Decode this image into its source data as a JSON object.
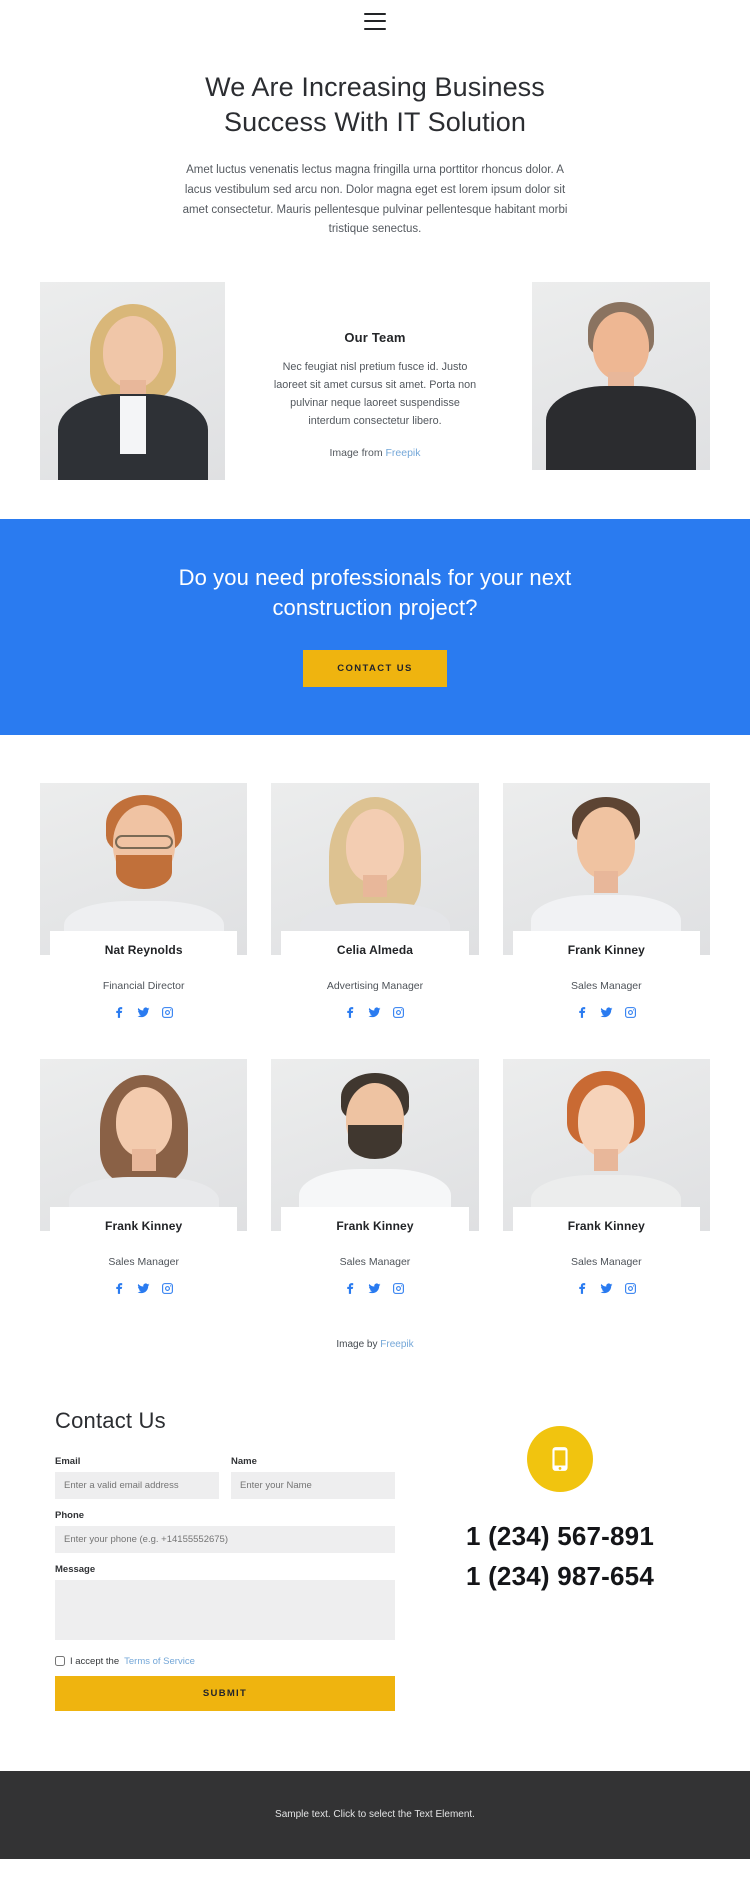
{
  "nav": {
    "menu_icon": "hamburger-menu-icon"
  },
  "hero": {
    "title_line1": "We Are Increasing Business",
    "title_line2": "Success With IT Solution",
    "lead": "Amet luctus venenatis lectus magna fringilla urna porttitor rhoncus dolor. A lacus vestibulum sed arcu non. Dolor magna eget est lorem ipsum dolor sit amet consectetur. Mauris pellentesque pulvinar pellentesque habitant morbi tristique senectus."
  },
  "intro": {
    "heading": "Our Team",
    "body": "Nec feugiat nisl pretium fusce id. Justo laoreet sit amet cursus sit amet. Porta non pulvinar neque laoreet suspendisse interdum consectetur libero.",
    "credit_prefix": "Image from ",
    "credit_link": "Freepik"
  },
  "cta": {
    "heading_line1": "Do you need professionals for your next",
    "heading_line2": "construction project?",
    "button_label": "CONTACT US",
    "background_color": "#2a7bf0",
    "button_color": "#efb40f"
  },
  "team": {
    "members": [
      {
        "name": "Nat Reynolds",
        "role": "Financial Director"
      },
      {
        "name": "Celia Almeda",
        "role": "Advertising Manager"
      },
      {
        "name": "Frank Kinney",
        "role": "Sales Manager"
      },
      {
        "name": "Frank Kinney",
        "role": "Sales Manager"
      },
      {
        "name": "Frank Kinney",
        "role": "Sales Manager"
      },
      {
        "name": "Frank Kinney",
        "role": "Sales Manager"
      }
    ],
    "social_icons": [
      "facebook-icon",
      "twitter-icon",
      "instagram-icon"
    ],
    "credit_prefix": "Image by ",
    "credit_link": "Freepik"
  },
  "contact": {
    "title": "Contact Us",
    "email_label": "Email",
    "email_placeholder": "Enter a valid email address",
    "email_value": "",
    "name_label": "Name",
    "name_placeholder": "Enter your Name",
    "name_value": "",
    "phone_label": "Phone",
    "phone_placeholder": "Enter your phone (e.g. +14155552675)",
    "phone_value": "",
    "message_label": "Message",
    "message_placeholder": "",
    "message_value": "",
    "terms_prefix": "I accept the ",
    "terms_link": "Terms of Service",
    "submit_label": "SUBMIT",
    "phone_icon": "mobile-phone-icon",
    "phone_number_1": "1 (234) 567-891",
    "phone_number_2": "1 (234) 987-654",
    "badge_color": "#f1c40f"
  },
  "footer": {
    "text": "Sample text. Click to select the Text Element."
  }
}
